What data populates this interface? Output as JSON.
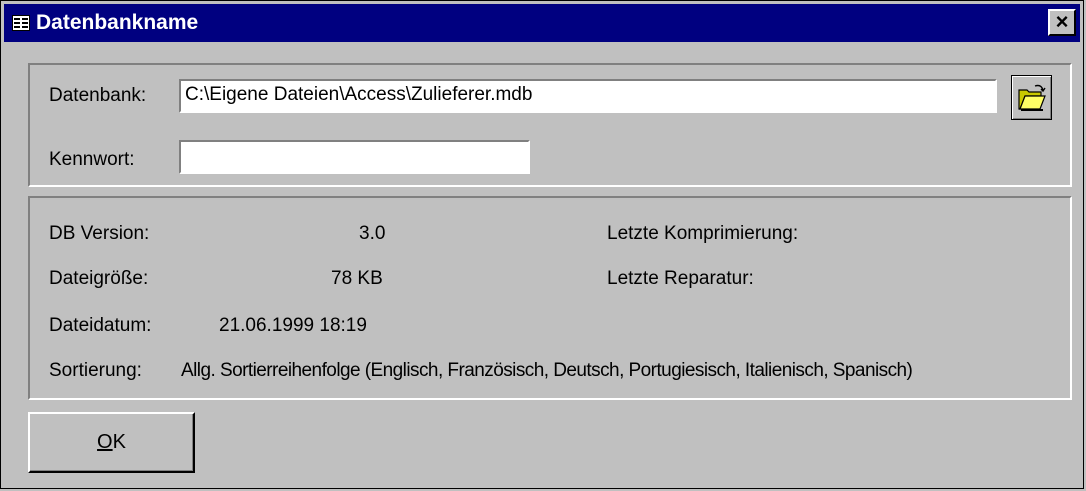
{
  "window": {
    "title": "Datenbankname",
    "close_label": "×"
  },
  "database": {
    "label": "Datenbank:",
    "value": "C:\\Eigene Dateien\\Access\\Zulieferer.mdb",
    "browse_icon": "folder-open-icon"
  },
  "password": {
    "label": "Kennwort:",
    "value": ""
  },
  "info": {
    "version_label": "DB Version:",
    "version_value": "3.0",
    "size_label": "Dateigröße:",
    "size_value": "78 KB",
    "date_label": "Dateidatum:",
    "date_value": "21.06.1999 18:19",
    "sort_label": "Sortierung:",
    "sort_value": "Allg. Sortierreihenfolge (Englisch, Französisch, Deutsch, Portugiesisch, Italienisch, Spanisch)",
    "compact_label": "Letzte Komprimierung:",
    "compact_value": "",
    "repair_label": "Letzte Reparatur:",
    "repair_value": ""
  },
  "buttons": {
    "ok_accel": "O",
    "ok_rest": "K"
  },
  "colors": {
    "titlebar": "#000080",
    "face": "#c0c0c0"
  }
}
